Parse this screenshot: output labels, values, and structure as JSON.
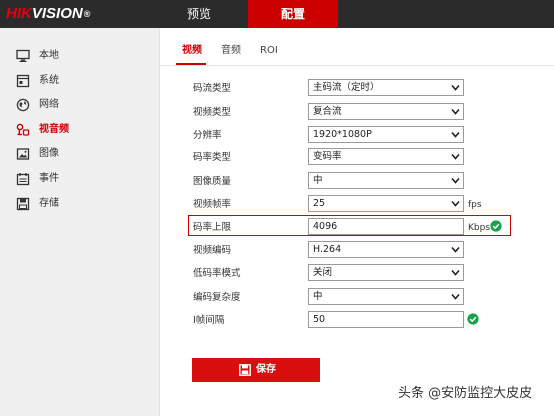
{
  "header": {
    "logo_brand": "HIKVISION",
    "logo_reg": "®",
    "nav": [
      {
        "label": "预览"
      },
      {
        "label": "配置"
      }
    ]
  },
  "sidebar": {
    "items": [
      {
        "label": "本地",
        "icon": "monitor-icon"
      },
      {
        "label": "系统",
        "icon": "system-icon"
      },
      {
        "label": "网络",
        "icon": "globe-icon"
      },
      {
        "label": "视音频",
        "icon": "audio-video-icon",
        "active": true
      },
      {
        "label": "图像",
        "icon": "image-icon"
      },
      {
        "label": "事件",
        "icon": "calendar-icon"
      },
      {
        "label": "存储",
        "icon": "storage-icon"
      }
    ]
  },
  "subtabs": [
    {
      "label": "视频",
      "active": true
    },
    {
      "label": "音频"
    },
    {
      "label": "ROI"
    }
  ],
  "form": {
    "stream_type": {
      "label": "码流类型",
      "value": "主码流（定时）"
    },
    "video_type": {
      "label": "视频类型",
      "value": "复合流"
    },
    "resolution": {
      "label": "分辨率",
      "value": "1920*1080P"
    },
    "bitrate_type": {
      "label": "码率类型",
      "value": "变码率"
    },
    "image_quality": {
      "label": "图像质量",
      "value": "中"
    },
    "frame_rate": {
      "label": "视频帧率",
      "value": "25",
      "unit": "fps"
    },
    "max_bitrate": {
      "label": "码率上限",
      "value": "4096",
      "unit": "Kbps"
    },
    "encoding": {
      "label": "视频编码",
      "value": "H.264"
    },
    "low_bitrate_mode": {
      "label": "低码率模式",
      "value": "关闭"
    },
    "encode_complexity": {
      "label": "编码复杂度",
      "value": "中"
    },
    "i_frame_interval": {
      "label": "I帧间隔",
      "value": "50"
    }
  },
  "save_button": {
    "label": "保存"
  },
  "watermark": "头条 @安防监控大皮皮",
  "colors": {
    "accent": "#cc0000",
    "topbar": "#2b2b2b",
    "sidebar": "#f0f0f0",
    "ok": "#1aa34a"
  }
}
